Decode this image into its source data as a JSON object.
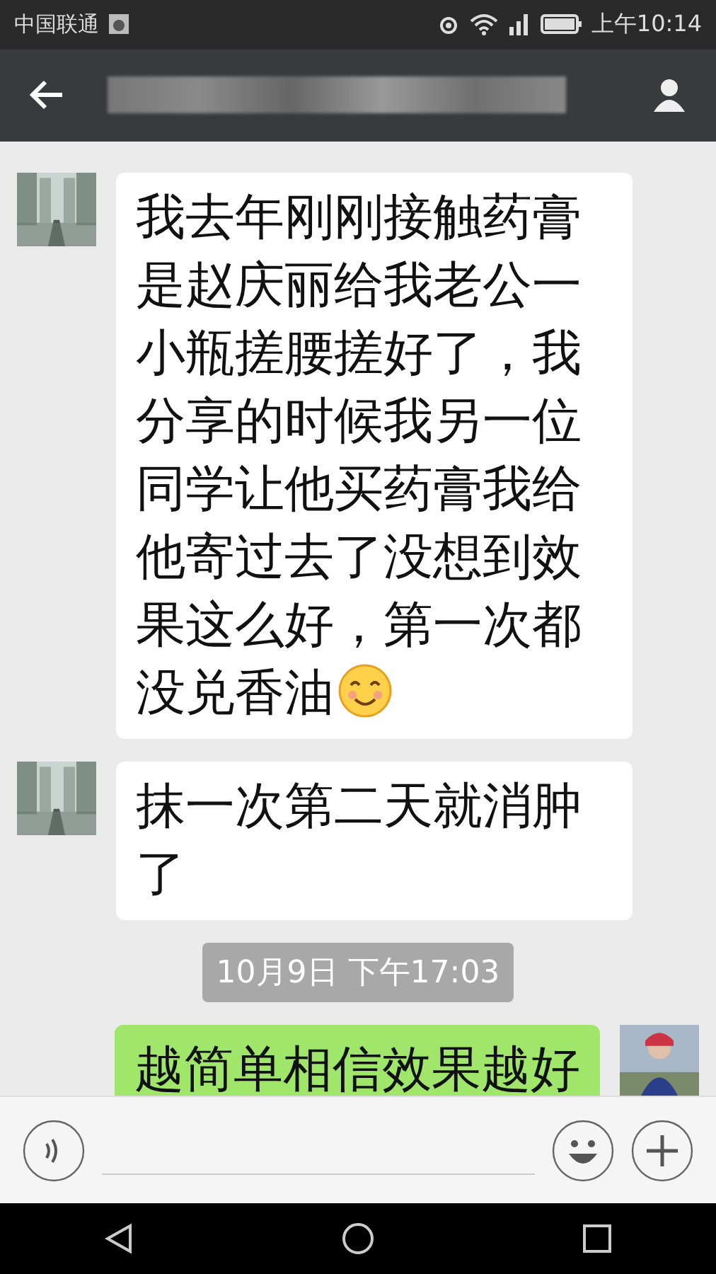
{
  "status_bar": {
    "carrier": "中国联通",
    "time": "上午10:14"
  },
  "messages": [
    {
      "kind": "incoming",
      "text": "我去年刚刚接触药膏是赵庆丽给我老公一小瓶搓腰搓好了，我分享的时候我另一位同学让他买药膏我给他寄过去了没想到效果这么好，第一次都没兑香油",
      "has_smiley": true
    },
    {
      "kind": "incoming",
      "text": "抹一次第二天就消肿了",
      "has_smiley": false
    },
    {
      "kind": "timestamp",
      "text": "10月9日 下午17:03"
    },
    {
      "kind": "outgoing",
      "text": "越简单相信效果越好",
      "has_smiley": false
    }
  ]
}
